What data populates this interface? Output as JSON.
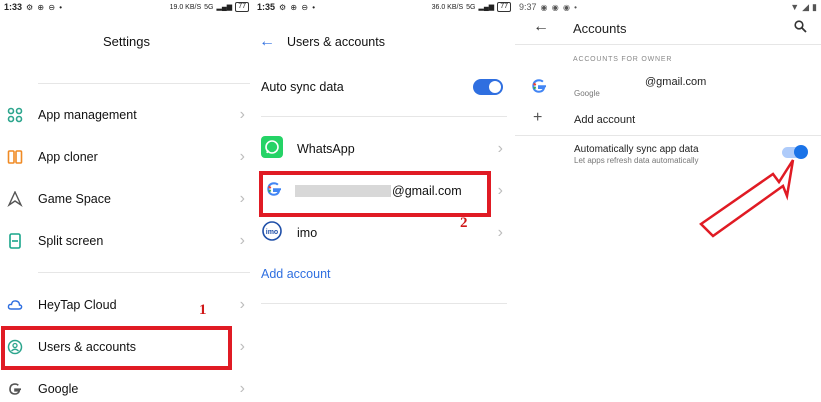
{
  "panel1": {
    "status": {
      "time": "1:33",
      "icons": "⚙ ⊕ ⊖ •",
      "speed": "19.0 KB/S",
      "network": "5G",
      "battery": "77"
    },
    "title": "Settings",
    "items": [
      {
        "label": "App management",
        "icon": "apps-grid-icon"
      },
      {
        "label": "App cloner",
        "icon": "app-cloner-icon"
      },
      {
        "label": "Game Space",
        "icon": "game-space-icon"
      },
      {
        "label": "Split screen",
        "icon": "split-screen-icon"
      },
      {
        "label": "HeyTap Cloud",
        "icon": "cloud-icon"
      },
      {
        "label": "Users & accounts",
        "icon": "user-account-icon"
      },
      {
        "label": "Google",
        "icon": "google-icon"
      }
    ],
    "annotation": "1"
  },
  "panel2": {
    "status": {
      "time": "1:35",
      "icons": "⚙ ⊕ ⊖ •",
      "speed": "36.0 KB/S",
      "network": "5G",
      "battery": "77"
    },
    "title": "Users & accounts",
    "auto_sync_label": "Auto sync data",
    "accounts": [
      {
        "label": "WhatsApp",
        "icon": "whatsapp-icon"
      },
      {
        "label": "@gmail.com",
        "icon": "google-icon"
      },
      {
        "label": "imo",
        "icon": "imo-icon"
      }
    ],
    "add_account": "Add account",
    "annotation": "2"
  },
  "panel3": {
    "status": {
      "time": "9:37"
    },
    "title": "Accounts",
    "section": "ACCOUNTS FOR OWNER",
    "email": "@gmail.com",
    "email_provider": "Google",
    "add_account": "Add account",
    "sync_title": "Automatically sync app data",
    "sync_subtitle": "Let apps refresh data automatically"
  },
  "colors": {
    "accent": "#2f6fe0",
    "annotation": "#e01b24"
  }
}
